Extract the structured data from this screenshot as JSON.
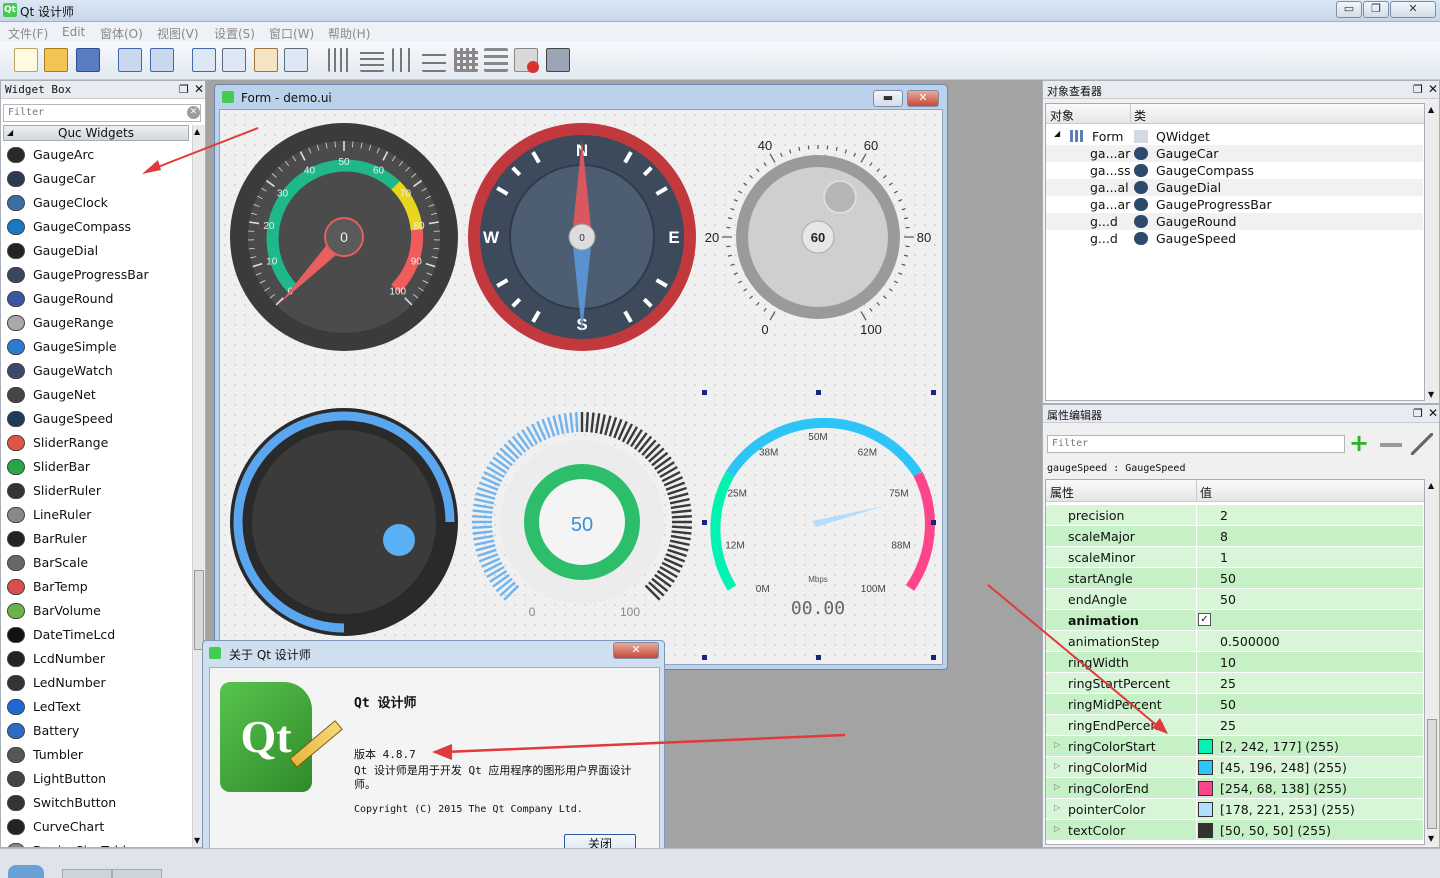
{
  "app": {
    "title": "Qt 设计师"
  },
  "menu": [
    "文件(F)",
    "Edit",
    "窗体(O)",
    "视图(V)",
    "设置(S)",
    "窗口(W)",
    "帮助(H)"
  ],
  "widget_box": {
    "title": "Widget Box",
    "filter_placeholder": "Filter",
    "category": "Quc Widgets",
    "items": [
      "GaugeArc",
      "GaugeCar",
      "GaugeClock",
      "GaugeCompass",
      "GaugeDial",
      "GaugeProgressBar",
      "GaugeRound",
      "GaugeRange",
      "GaugeSimple",
      "GaugeWatch",
      "GaugeNet",
      "GaugeSpeed",
      "SliderRange",
      "SliderBar",
      "SliderRuler",
      "LineRuler",
      "BarRuler",
      "BarScale",
      "BarTemp",
      "BarVolume",
      "DateTimeLcd",
      "LcdNumber",
      "LedNumber",
      "LedText",
      "Battery",
      "Tumbler",
      "LightButton",
      "SwitchButton",
      "CurveChart",
      "DeviceSizeTable"
    ]
  },
  "form": {
    "title": "Form - demo.ui",
    "car": {
      "ticks": [
        "0",
        "10",
        "20",
        "30",
        "40",
        "50",
        "60",
        "70",
        "80",
        "90",
        "100"
      ],
      "value": "0"
    },
    "compass": {
      "n": "N",
      "s": "S",
      "e": "E",
      "w": "W",
      "value": "0"
    },
    "dial": {
      "ticks": [
        "0",
        "20",
        "40",
        "60",
        "80",
        "100"
      ],
      "value": "60"
    },
    "progress": {
      "value": "50",
      "min": "0",
      "max": "100"
    },
    "speed": {
      "labels": [
        "0M",
        "12M",
        "25M",
        "38M",
        "50M",
        "62M",
        "75M",
        "88M",
        "100M"
      ],
      "unit": "Mbps",
      "lcd": "00.00"
    }
  },
  "object_inspector": {
    "title": "对象查看器",
    "col_object": "对象",
    "col_class": "类",
    "rows": [
      {
        "name": "Form",
        "cls": "QWidget"
      },
      {
        "name": "ga...ar",
        "cls": "GaugeCar"
      },
      {
        "name": "ga...ss",
        "cls": "GaugeCompass"
      },
      {
        "name": "ga...al",
        "cls": "GaugeDial"
      },
      {
        "name": "ga...ar",
        "cls": "GaugeProgressBar"
      },
      {
        "name": "g...d",
        "cls": "GaugeRound"
      },
      {
        "name": "g...d",
        "cls": "GaugeSpeed"
      }
    ]
  },
  "property_editor": {
    "title": "属性编辑器",
    "filter_placeholder": "Filter",
    "context": "gaugeSpeed : GaugeSpeed",
    "col_prop": "属性",
    "col_value": "值",
    "rows": [
      {
        "k": "precision",
        "v": "2"
      },
      {
        "k": "scaleMajor",
        "v": "8"
      },
      {
        "k": "scaleMinor",
        "v": "1"
      },
      {
        "k": "startAngle",
        "v": "50"
      },
      {
        "k": "endAngle",
        "v": "50"
      },
      {
        "k": "animation",
        "v": "",
        "check": true,
        "bold": true
      },
      {
        "k": "animationStep",
        "v": "0.500000"
      },
      {
        "k": "ringWidth",
        "v": "10"
      },
      {
        "k": "ringStartPercent",
        "v": "25"
      },
      {
        "k": "ringMidPercent",
        "v": "50"
      },
      {
        "k": "ringEndPercent",
        "v": "25"
      },
      {
        "k": "ringColorStart",
        "v": "[2, 242, 177] (255)",
        "color": "#02f2b1"
      },
      {
        "k": "ringColorMid",
        "v": "[45, 196, 248] (255)",
        "color": "#2dc4f8"
      },
      {
        "k": "ringColorEnd",
        "v": "[254, 68, 138] (255)",
        "color": "#fe448a"
      },
      {
        "k": "pointerColor",
        "v": "[178, 221, 253] (255)",
        "color": "#b2ddfd"
      },
      {
        "k": "textColor",
        "v": "[50, 50, 50] (255)",
        "color": "#323232"
      }
    ]
  },
  "about": {
    "title": "关于 Qt 设计师",
    "heading": "Qt 设计师",
    "version": "版本 4.8.7",
    "desc1": "Qt 设计师是用于开发 Qt 应用程序的图形用户界面设计",
    "desc2": "师。",
    "copyright": "Copyright (C) 2015 The Qt Company Ltd.",
    "close": "关闭"
  }
}
